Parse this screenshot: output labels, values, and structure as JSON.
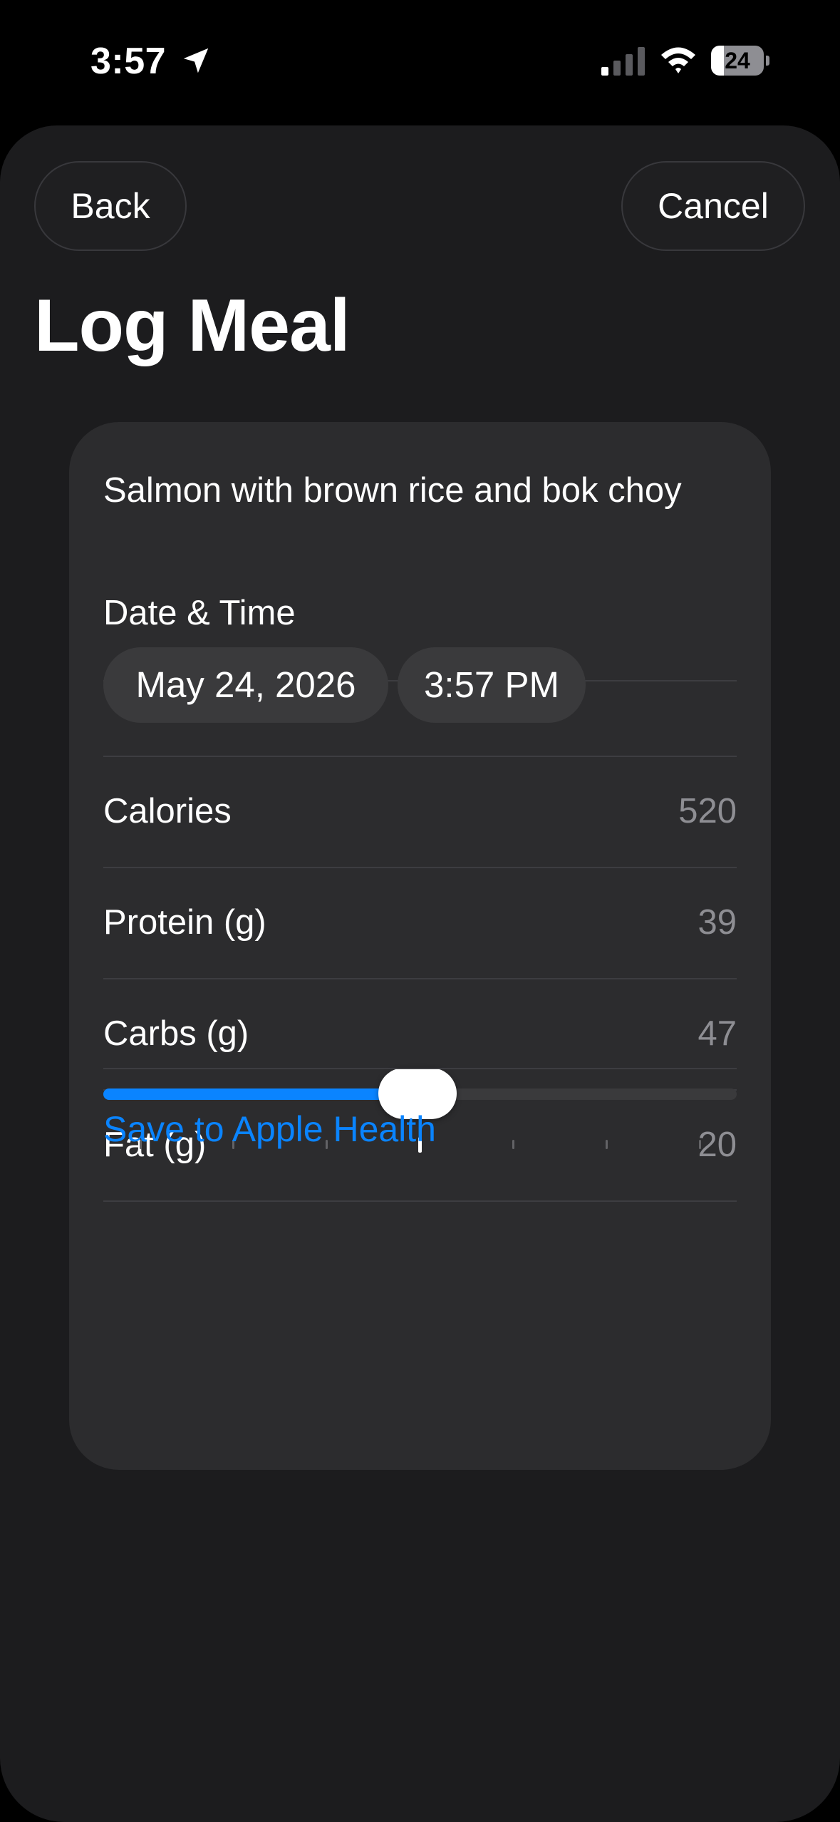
{
  "status_bar": {
    "time": "3:57",
    "battery_level": "24",
    "battery_fraction": 0.24,
    "icons": [
      "location-arrow-icon",
      "cellular-signal-icon",
      "wifi-icon",
      "battery-icon"
    ]
  },
  "nav": {
    "back_label": "Back",
    "cancel_label": "Cancel"
  },
  "page": {
    "title": "Log Meal"
  },
  "meal": {
    "name": "Salmon with brown rice and bok choy",
    "datetime_label": "Date & Time",
    "date": "May 24, 2026",
    "time": "3:57 PM"
  },
  "nutrition": [
    {
      "label": "Calories",
      "value": "520"
    },
    {
      "label": "Protein (g)",
      "value": "39"
    },
    {
      "label": "Carbs (g)",
      "value": "47"
    },
    {
      "label": "Fat (g)",
      "value": "20"
    }
  ],
  "slider": {
    "tick_count": 7,
    "selected_index": 3,
    "fraction": 0.5
  },
  "actions": {
    "save_health_label": "Save to Apple Health"
  },
  "colors": {
    "accent": "#0a84ff",
    "background": "#000000",
    "sheet": "#1c1c1e",
    "card": "#2c2c2e",
    "secondary_text": "#8e8e93"
  }
}
